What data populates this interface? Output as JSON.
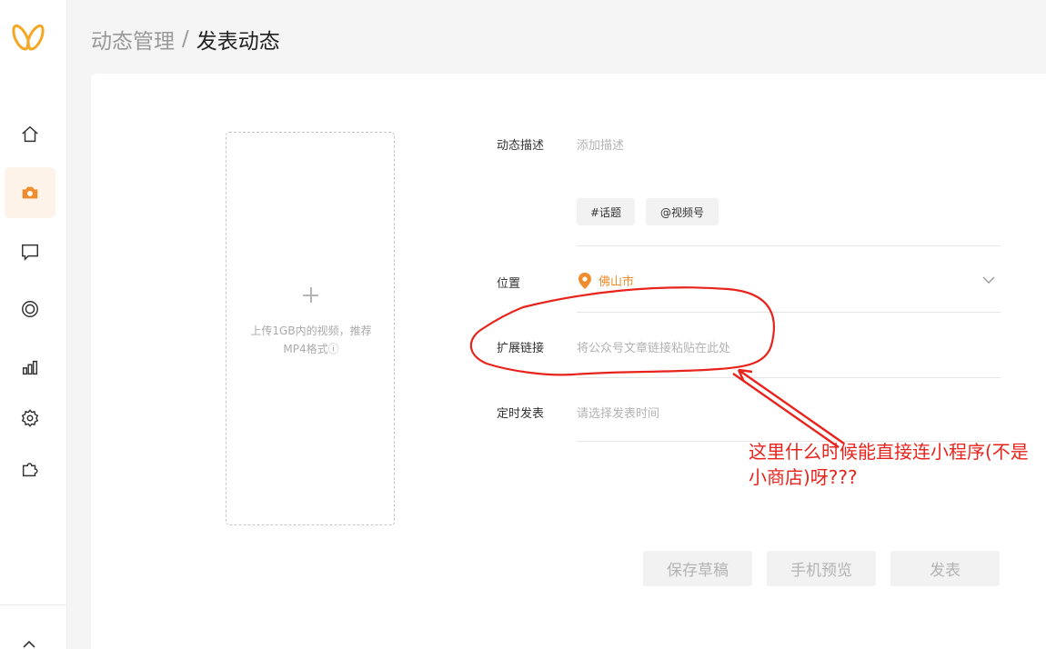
{
  "breadcrumb": {
    "parent": "动态管理",
    "separator": "/",
    "current": "发表动态"
  },
  "sidebar": {
    "items": [
      {
        "icon": "home-icon"
      },
      {
        "icon": "camera-icon",
        "active": true
      },
      {
        "icon": "chat-icon"
      },
      {
        "icon": "live-icon"
      },
      {
        "icon": "chart-icon"
      },
      {
        "icon": "gear-icon"
      },
      {
        "icon": "plugin-icon"
      }
    ],
    "accent": "#f08c2d"
  },
  "upload": {
    "hint": "上传1GB内的视频，推荐MP4格式ⓘ"
  },
  "form": {
    "description": {
      "label": "动态描述",
      "placeholder": "添加描述"
    },
    "tags": {
      "topic": "#话题",
      "channel": "@视频号"
    },
    "location": {
      "label": "位置",
      "value": "佛山市"
    },
    "link": {
      "label": "扩展链接",
      "placeholder": "将公众号文章链接粘贴在此处"
    },
    "schedule": {
      "label": "定时发表",
      "placeholder": "请选择发表时间"
    }
  },
  "actions": {
    "save_draft": "保存草稿",
    "preview": "手机预览",
    "publish": "发表"
  },
  "annotation": {
    "text": "这里什么时候能直接连小程序(不是小商店)呀???",
    "color": "#e8231c"
  }
}
